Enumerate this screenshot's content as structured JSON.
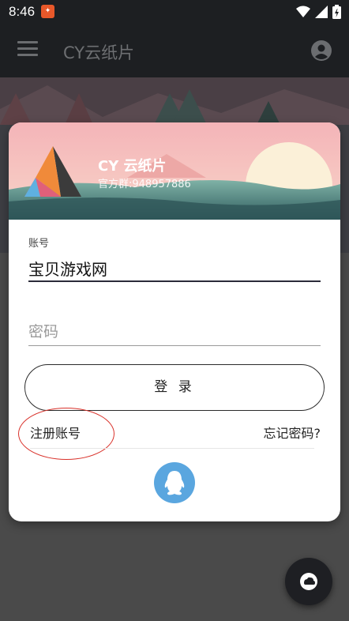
{
  "status_bar": {
    "time": "8:46",
    "notification_icon": "app-notification-icon"
  },
  "app_bar": {
    "title": "CY云纸片",
    "menu_icon": "menu-icon",
    "account_icon": "account-circle-icon"
  },
  "login_card": {
    "brand_title": "CY 云纸片",
    "brand_subtitle": "官方群:948957886",
    "account_label": "账号",
    "account_value": "宝贝游戏网",
    "password_placeholder": "密码",
    "login_label": "登 录",
    "register_label": "注册账号",
    "forgot_label": "忘记密码?",
    "qq_icon": "qq-penguin-icon"
  },
  "fab": {
    "icon": "cloud-icon"
  },
  "colors": {
    "accent_circle": "#d9322b",
    "qq_blue": "#5aa6df",
    "app_bar": "#1d1f22"
  }
}
